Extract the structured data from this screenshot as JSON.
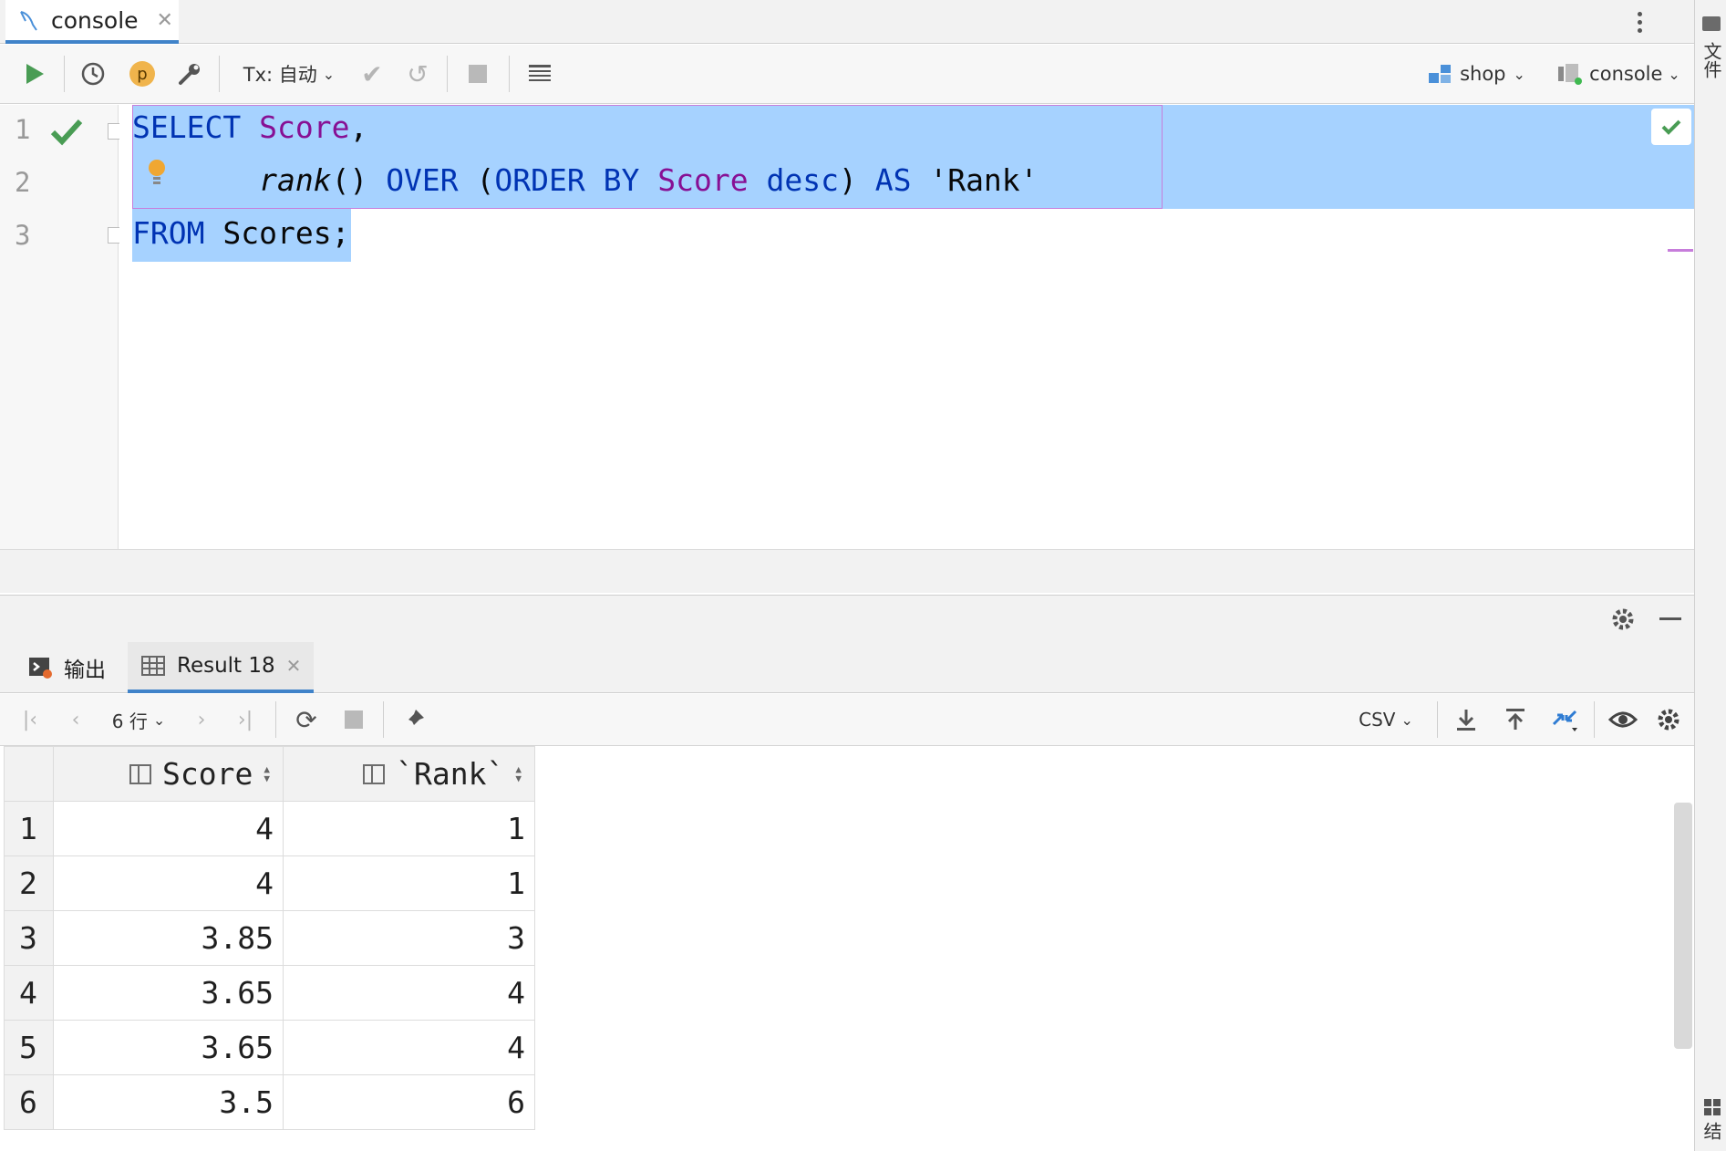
{
  "tabbar": {
    "tab_label": "console"
  },
  "right_strip": {
    "top_text": "文件",
    "bottom_text": "结"
  },
  "toolbar": {
    "tx_label": "Tx: 自动",
    "profile_badge": "p",
    "datasource_label": "shop",
    "session_label": "console"
  },
  "editor": {
    "line_numbers": [
      "1",
      "2",
      "3"
    ],
    "line1": {
      "kw": "SELECT",
      "col": "Score",
      "punct": ","
    },
    "line2": {
      "fn": "rank",
      "paren": "()",
      "over": "OVER",
      "lparen": "(",
      "order_by": "ORDER BY",
      "col": "Score",
      "desc": "desc",
      "rparen": ")",
      "as": "AS",
      "alias": "'Rank'"
    },
    "line3": {
      "kw": "FROM",
      "table": "Scores;"
    }
  },
  "panel_tabs": {
    "output_label": "输出",
    "result_label": "Result 18"
  },
  "result_toolbar": {
    "rows_label": "6 行",
    "export_format": "CSV"
  },
  "grid": {
    "columns": [
      "Score",
      "`Rank`"
    ],
    "rows": [
      {
        "n": "1",
        "score": "4",
        "rank": "1"
      },
      {
        "n": "2",
        "score": "4",
        "rank": "1"
      },
      {
        "n": "3",
        "score": "3.85",
        "rank": "3"
      },
      {
        "n": "4",
        "score": "3.65",
        "rank": "4"
      },
      {
        "n": "5",
        "score": "3.65",
        "rank": "4"
      },
      {
        "n": "6",
        "score": "3.5",
        "rank": "6"
      }
    ]
  },
  "colors": {
    "accent": "#4083c9",
    "selection": "#a6d2ff",
    "keyword": "#0033b3",
    "column": "#871094",
    "run_green": "#499c54"
  }
}
